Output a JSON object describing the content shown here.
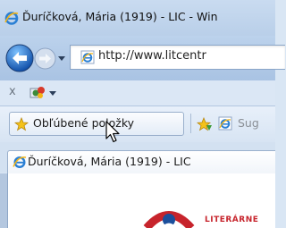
{
  "window": {
    "title": "Ďuríčková, Mária (1919) - LIC - Win"
  },
  "address_bar": {
    "url": "http://www.litcentr"
  },
  "toolbar": {
    "close_glyph": "x",
    "compat_icon": "compatibility-view-icon"
  },
  "favorites_bar": {
    "favorites_button_label": "Obľúbené položky",
    "suggested_sites_label": "Sug"
  },
  "tabs": [
    {
      "label": "Ďuríčková, Mária (1919) - LIC",
      "icon": "ie-page-icon"
    }
  ],
  "page": {
    "logo_text": "LITERÁRNE"
  },
  "colors": {
    "ie_blue": "#2a7fd4",
    "ie_gold": "#f4b516",
    "logo_red": "#c7242c",
    "logo_blue": "#1c4f9c"
  }
}
